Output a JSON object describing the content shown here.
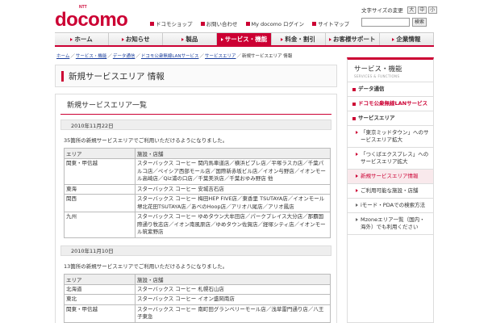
{
  "logo": {
    "nt": "NTT",
    "text": "docomo"
  },
  "font_size": {
    "label": "文字サイズの変更",
    "options": [
      "大",
      "中",
      "小"
    ]
  },
  "util_links": [
    "ドコモショップ",
    "お問い合わせ",
    "My docomo ログイン",
    "サイトマップ"
  ],
  "search": {
    "placeholder": "",
    "button": "検索"
  },
  "gnav": [
    {
      "label": "ホーム",
      "active": false
    },
    {
      "label": "お知らせ",
      "active": false
    },
    {
      "label": "製品",
      "active": false
    },
    {
      "label": "サービス・機能",
      "active": true
    },
    {
      "label": "料金・割引",
      "active": false
    },
    {
      "label": "お客様サポート",
      "active": false
    },
    {
      "label": "企業情報",
      "active": false
    }
  ],
  "breadcrumb": {
    "links": [
      "ホーム",
      "サービス・機能",
      "データ通信",
      "ドコモ公衆無線LANサービス",
      "サービスエリア"
    ],
    "current": "新規サービスエリア 情報"
  },
  "page_title": "新規サービスエリア 情報",
  "section_title": "新規サービスエリア一覧",
  "table_headers": [
    "エリア",
    "施設・店舗"
  ],
  "blocks": [
    {
      "date": "2010年11月22日",
      "note": "35箇所の新規サービスエリアでご利用いただけるようになりました。",
      "rows": [
        {
          "area": "関東・甲信越",
          "shops": "スターバックス コーヒー 関内馬車道店／横浜ビブレ店／平塚ラスカ店／千葉パルコ店／ペイシア西部モール店／国際新赤坂ビル店／イオン与野店／イオンモール高崎店／Qiz浦の口店／千葉美浜店／千葉おゆみ野店 他"
        },
        {
          "area": "東海",
          "shops": "スターバックス コーヒー 安城吉石店"
        },
        {
          "area": "関西",
          "shops": "スターバックス コーヒー 梅田HEP FIVE店／東香里 TSUTAYA店／イオンモール堺北花田TSUTAYA店／あべのHoop店／アリオ八尾店／アリオ鳳店"
        },
        {
          "area": "九州",
          "shops": "スターバックス コーヒー ゆめタウン大牟田店／パークプレイス大分店／那覇国際通り牧志店／イオン南風原店／ゆめタウン佐賀店／経塚シティ店／イオンモール筑紫野店"
        }
      ]
    },
    {
      "date": "2010年11月10日",
      "note": "13箇所の新規サービスエリアでご利用いただけるようになりました。",
      "rows": [
        {
          "area": "北海道",
          "shops": "スターバックス コーヒー 札幌石山店"
        },
        {
          "area": "東北",
          "shops": "スターバックス コーヒー イオン盛岡南店"
        },
        {
          "area": "関東・甲信越",
          "shops": "スターバックス コーヒー 南町田グランベリーモール店／浅草雷門通り店／八王子東急"
        }
      ]
    }
  ],
  "sidebar": {
    "title": "サービス・機能",
    "subtitle": "SERVICES & FUNCTIONS",
    "items": [
      {
        "label": "データ通信",
        "level": "lvl1",
        "mark": "bullet"
      },
      {
        "label": "ドコモ公衆無線LANサービス",
        "level": "lvl2",
        "mark": "bullet",
        "red": true
      },
      {
        "label": "サービスエリア",
        "level": "lvl1",
        "mark": "bullet"
      },
      {
        "label": "「東京ミッドタウン」へのサービスエリア拡大",
        "level": "lvl3",
        "mark": "arrow"
      },
      {
        "label": "「つくばエクスプレス」へのサービスエリア拡大",
        "level": "lvl3",
        "mark": "arrow"
      },
      {
        "label": "新規サービスエリア情報",
        "level": "lvl3",
        "mark": "arrow",
        "current": true
      },
      {
        "label": "ご利用可能な施設・店舗",
        "level": "lvl3",
        "mark": "arrow"
      },
      {
        "label": "iモード・PDAでの検索方法",
        "level": "lvl3",
        "mark": "tri"
      },
      {
        "label": "Mzoneエリア一覧（国内・海外）でも利用ください",
        "level": "lvl3",
        "mark": "tri"
      }
    ]
  },
  "colors": {
    "brand": "#cc0033",
    "link": "#1a3e9c"
  }
}
